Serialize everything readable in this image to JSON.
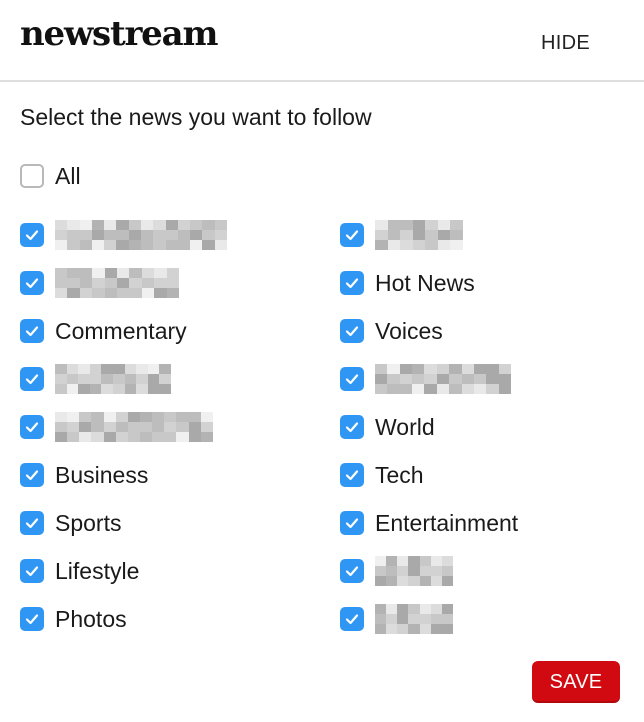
{
  "header": {
    "logo": "newstream",
    "hide_label": "HIDE"
  },
  "prompt": "Select the news you want to follow",
  "all": {
    "label": "All",
    "checked": false
  },
  "left_column": [
    {
      "label": "",
      "checked": true,
      "blurred": true
    },
    {
      "label": "",
      "checked": true,
      "blurred": true
    },
    {
      "label": "Commentary",
      "checked": true
    },
    {
      "label": "",
      "checked": true,
      "blurred": true
    },
    {
      "label": "",
      "checked": true,
      "blurred": true
    },
    {
      "label": "Business",
      "checked": true
    },
    {
      "label": "Sports",
      "checked": true
    },
    {
      "label": "Lifestyle",
      "checked": true
    },
    {
      "label": "Photos",
      "checked": true
    }
  ],
  "right_column": [
    {
      "label": "",
      "checked": true,
      "blurred": true
    },
    {
      "label": "Hot News",
      "checked": true
    },
    {
      "label": "Voices",
      "checked": true
    },
    {
      "label": "",
      "checked": true,
      "blurred": true
    },
    {
      "label": "World",
      "checked": true
    },
    {
      "label": "Tech",
      "checked": true
    },
    {
      "label": "Entertainment",
      "checked": true
    },
    {
      "label": "",
      "checked": true,
      "blurred": true
    },
    {
      "label": "",
      "checked": true,
      "blurred": true
    }
  ],
  "save_label": "SAVE",
  "colors": {
    "checkbox": "#2f96f3",
    "save": "#d10a11",
    "divider": "#dedede"
  }
}
